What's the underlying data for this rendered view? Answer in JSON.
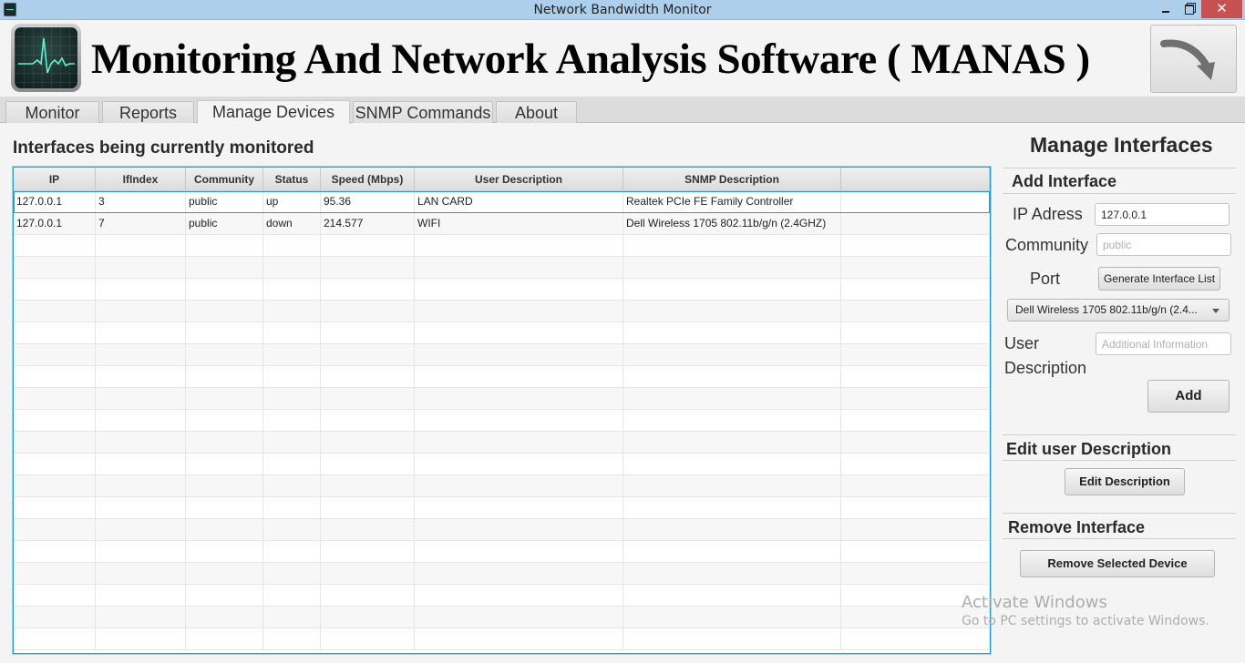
{
  "window": {
    "title": "Network Bandwidth Monitor",
    "controls": {
      "minimize": "minimize",
      "maximize": "restore",
      "close": "✕"
    }
  },
  "header": {
    "app_title": "Monitoring And Network Analysis Software ( MANAS )",
    "logo_icon": "activity-monitor-icon",
    "next_icon": "curved-arrow-icon"
  },
  "tabs": [
    {
      "label": "Monitor",
      "active": false
    },
    {
      "label": "Reports",
      "active": false
    },
    {
      "label": "Manage Devices",
      "active": true
    },
    {
      "label": "SNMP Commands",
      "active": false
    },
    {
      "label": "About",
      "active": false
    }
  ],
  "monitored": {
    "heading": "Interfaces being currently monitored",
    "columns": [
      "IP",
      "IfIndex",
      "Community",
      "Status",
      "Speed (Mbps)",
      "User Description",
      "SNMP Description",
      ""
    ],
    "rows": [
      [
        "127.0.0.1",
        "3",
        "public",
        "up",
        "95.36",
        "LAN CARD",
        "Realtek PCIe FE Family Controller",
        ""
      ],
      [
        "127.0.0.1",
        "7",
        "public",
        "down",
        "214.577",
        "WIFI",
        "Dell Wireless 1705 802.11b/g/n (2.4GHZ)",
        ""
      ]
    ],
    "selected_row": 0
  },
  "manage": {
    "title": "Manage Interfaces",
    "add": {
      "title": "Add Interface",
      "ip_label": "IP Adress",
      "ip_value": "127.0.0.1",
      "community_label": "Community",
      "community_value": "",
      "community_placeholder": "public",
      "port_label": "Port",
      "generate_button": "Generate Interface List",
      "interface_selected": "Dell Wireless 1705 802.11b/g/n (2.4...",
      "user_label_1": "User",
      "user_label_2": "Description",
      "user_desc_value": "",
      "user_desc_placeholder": "Additional Information",
      "add_button": "Add"
    },
    "edit": {
      "title": "Edit user Description",
      "button": "Edit Description"
    },
    "remove": {
      "title": "Remove Interface",
      "button": "Remove Selected Device"
    }
  },
  "watermark": {
    "line1": "Activate Windows",
    "line2": "Go to PC settings to activate Windows."
  }
}
